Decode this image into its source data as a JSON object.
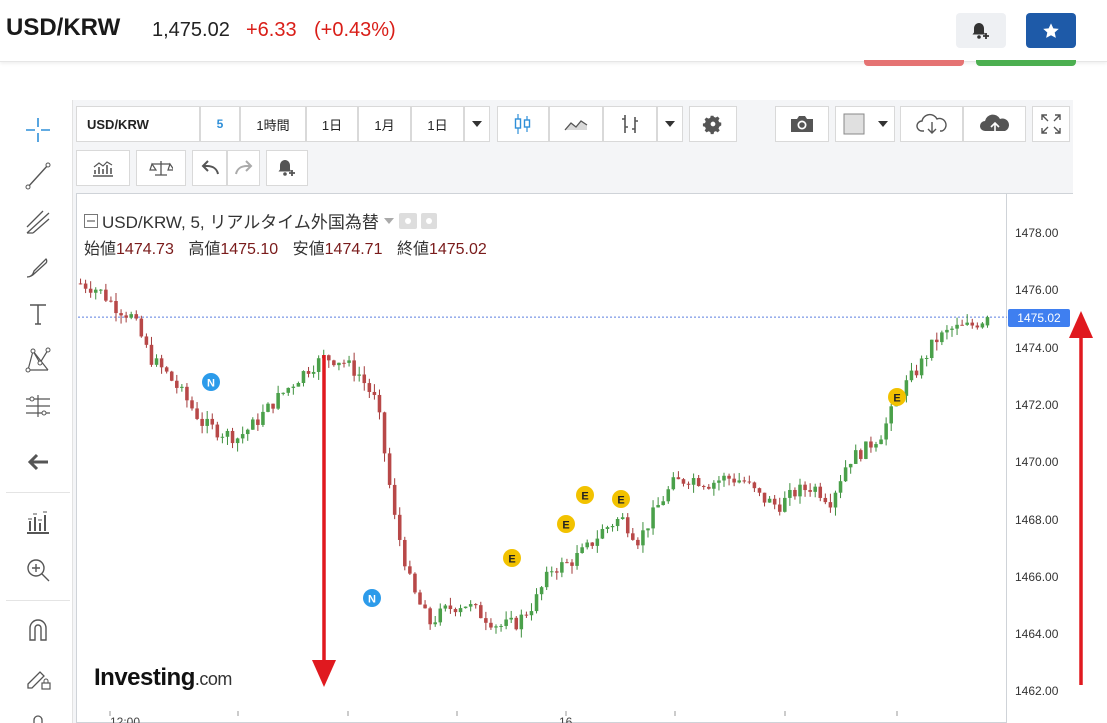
{
  "header": {
    "symbol": "USD/KRW",
    "price": "1,475.02",
    "change": "+6.33",
    "change_pct": "(+0.43%)",
    "colors": {
      "down_red": "#d91e18",
      "star_blue": "#1e5aa8"
    }
  },
  "toolbar": {
    "symbol": "USD/KRW",
    "interval": "5",
    "ranges": [
      "1時間",
      "1日",
      "1月",
      "1日"
    ]
  },
  "legend": {
    "title": "USD/KRW, 5, リアルタイム外国為替",
    "labels": {
      "open": "始値",
      "high": "高値",
      "low": "安値",
      "close": "終値"
    },
    "values": {
      "open": "1474.73",
      "high": "1475.10",
      "low": "1474.71",
      "close": "1475.02"
    }
  },
  "yaxis": {
    "ticks": [
      "1478.00",
      "1476.00",
      "1474.00",
      "1472.00",
      "1470.00",
      "1468.00",
      "1466.00",
      "1464.00",
      "1462.00"
    ],
    "current": "1475.02"
  },
  "xaxis": {
    "labels": [
      "12:00",
      "16"
    ]
  },
  "logo": {
    "main": "Investing",
    "suffix": ".com"
  },
  "event_markers": [
    "N",
    "N",
    "E",
    "E",
    "E",
    "E",
    "E"
  ],
  "chart_data": {
    "type": "candlestick",
    "symbol": "USD/KRW",
    "interval": "5",
    "ylim": [
      1462,
      1478
    ],
    "y_ticks": [
      1478,
      1476,
      1474,
      1472,
      1470,
      1468,
      1466,
      1464,
      1462
    ],
    "current_price": 1475.02,
    "last_candle": {
      "open": 1474.73,
      "high": 1475.1,
      "low": 1474.71,
      "close": 1475.02
    },
    "path_close_approx": [
      1476.2,
      1476.0,
      1475.4,
      1475.0,
      1473.6,
      1473.0,
      1472.2,
      1471.3,
      1471.0,
      1470.8,
      1471.3,
      1472.0,
      1472.6,
      1473.2,
      1473.6,
      1473.5,
      1473.0,
      1472.0,
      1468.0,
      1465.5,
      1464.3,
      1464.8,
      1465.0,
      1464.6,
      1464.2,
      1464.3,
      1465.0,
      1466.2,
      1466.4,
      1466.9,
      1467.6,
      1468.0,
      1467.2,
      1468.3,
      1469.2,
      1469.4,
      1469.2,
      1469.4,
      1469.3,
      1468.7,
      1468.4,
      1468.9,
      1469.1,
      1468.6,
      1470.0,
      1470.4,
      1471.0,
      1472.4,
      1473.2,
      1474.2,
      1474.6,
      1474.7,
      1475.02
    ]
  }
}
